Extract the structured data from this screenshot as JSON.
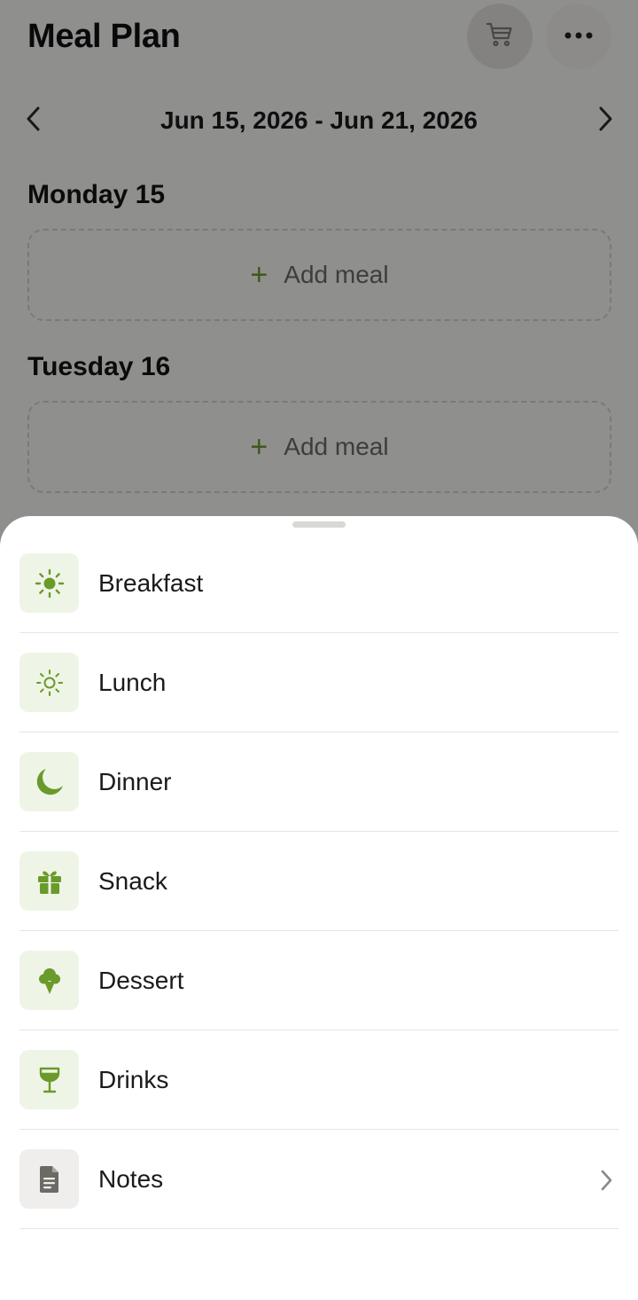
{
  "header": {
    "title": "Meal Plan"
  },
  "toolbar": {
    "cart_icon": "cart-icon",
    "more_icon": "more-icon"
  },
  "week": {
    "range": "Jun 15, 2026 - Jun 21, 2026"
  },
  "days": [
    {
      "title": "Monday 15",
      "add_label": "Add meal"
    },
    {
      "title": "Tuesday 16",
      "add_label": "Add meal"
    }
  ],
  "sheet": {
    "options": [
      {
        "label": "Breakfast",
        "icon": "sun-icon"
      },
      {
        "label": "Lunch",
        "icon": "sun-outline-icon"
      },
      {
        "label": "Dinner",
        "icon": "moon-icon"
      },
      {
        "label": "Snack",
        "icon": "gift-icon"
      },
      {
        "label": "Dessert",
        "icon": "ice-cream-icon"
      },
      {
        "label": "Drinks",
        "icon": "glass-icon"
      },
      {
        "label": "Notes",
        "icon": "document-icon"
      }
    ]
  },
  "colors": {
    "accent": "#6a9a2a",
    "icon_bg": "#eef5e6",
    "notes_icon": "#6d6a66"
  }
}
